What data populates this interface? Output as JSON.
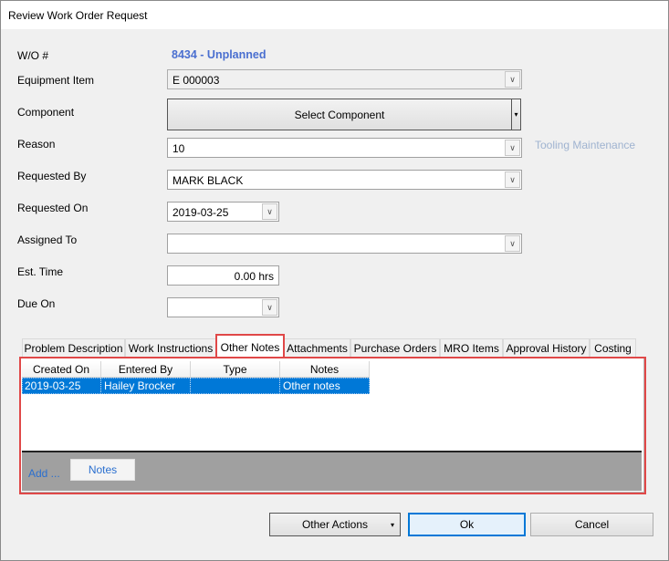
{
  "window": {
    "title": "Review Work Order Request"
  },
  "form": {
    "wo_label": "W/O #",
    "wo_value": "8434 - Unplanned",
    "equipment_label": "Equipment Item",
    "equipment_value": "E 000003",
    "component_label": "Component",
    "component_button": "Select Component",
    "reason_label": "Reason",
    "reason_value": "10",
    "reason_desc": "Tooling Maintenance",
    "requested_by_label": "Requested By",
    "requested_by_value": "MARK BLACK",
    "requested_on_label": "Requested On",
    "requested_on_value": "2019-03-25",
    "assigned_to_label": "Assigned To",
    "assigned_to_value": "",
    "est_time_label": "Est. Time",
    "est_time_value": "0.00 hrs",
    "due_on_label": "Due On",
    "due_on_value": ""
  },
  "tabs": [
    "Problem Description",
    "Work Instructions",
    "Other Notes",
    "Attachments",
    "Purchase Orders",
    "MRO Items",
    "Approval History",
    "Costing"
  ],
  "selected_tab": "Other Notes",
  "grid": {
    "columns": [
      "Created On",
      "Entered By",
      "Type",
      "Notes"
    ],
    "rows": [
      [
        "2019-03-25",
        "Hailey Brocker",
        "",
        "Other notes"
      ]
    ]
  },
  "panel": {
    "add_label": "Add ...",
    "notes_button": "Notes"
  },
  "footer": {
    "other_actions": "Other Actions",
    "ok": "Ok",
    "cancel": "Cancel"
  },
  "colors": {
    "accent": "#0078d7",
    "wo_value": "#4a6fd0",
    "highlight": "#e04848"
  }
}
